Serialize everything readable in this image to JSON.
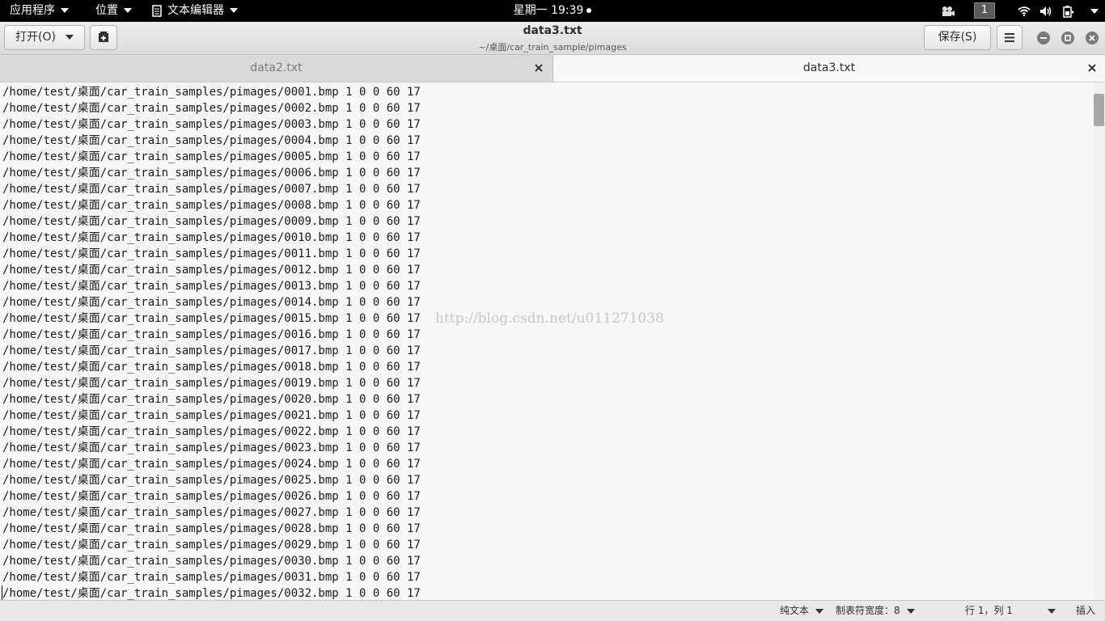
{
  "topbar": {
    "apps_menu": "应用程序",
    "places_menu": "位置",
    "app_menu": "文本编辑器",
    "clock": "星期一 19:39",
    "workspace": "1"
  },
  "header": {
    "open_button": "打开(O)",
    "title": "data3.txt",
    "subtitle": "~/桌面/car_train_sample/pimages",
    "save_button": "保存(S)"
  },
  "tabs": [
    {
      "label": "data2.txt",
      "active": false
    },
    {
      "label": "data3.txt",
      "active": true
    }
  ],
  "editor": {
    "lines": [
      "/home/test/桌面/car_train_samples/pimages/0001.bmp 1 0 0 60 17",
      "/home/test/桌面/car_train_samples/pimages/0002.bmp 1 0 0 60 17",
      "/home/test/桌面/car_train_samples/pimages/0003.bmp 1 0 0 60 17",
      "/home/test/桌面/car_train_samples/pimages/0004.bmp 1 0 0 60 17",
      "/home/test/桌面/car_train_samples/pimages/0005.bmp 1 0 0 60 17",
      "/home/test/桌面/car_train_samples/pimages/0006.bmp 1 0 0 60 17",
      "/home/test/桌面/car_train_samples/pimages/0007.bmp 1 0 0 60 17",
      "/home/test/桌面/car_train_samples/pimages/0008.bmp 1 0 0 60 17",
      "/home/test/桌面/car_train_samples/pimages/0009.bmp 1 0 0 60 17",
      "/home/test/桌面/car_train_samples/pimages/0010.bmp 1 0 0 60 17",
      "/home/test/桌面/car_train_samples/pimages/0011.bmp 1 0 0 60 17",
      "/home/test/桌面/car_train_samples/pimages/0012.bmp 1 0 0 60 17",
      "/home/test/桌面/car_train_samples/pimages/0013.bmp 1 0 0 60 17",
      "/home/test/桌面/car_train_samples/pimages/0014.bmp 1 0 0 60 17",
      "/home/test/桌面/car_train_samples/pimages/0015.bmp 1 0 0 60 17",
      "/home/test/桌面/car_train_samples/pimages/0016.bmp 1 0 0 60 17",
      "/home/test/桌面/car_train_samples/pimages/0017.bmp 1 0 0 60 17",
      "/home/test/桌面/car_train_samples/pimages/0018.bmp 1 0 0 60 17",
      "/home/test/桌面/car_train_samples/pimages/0019.bmp 1 0 0 60 17",
      "/home/test/桌面/car_train_samples/pimages/0020.bmp 1 0 0 60 17",
      "/home/test/桌面/car_train_samples/pimages/0021.bmp 1 0 0 60 17",
      "/home/test/桌面/car_train_samples/pimages/0022.bmp 1 0 0 60 17",
      "/home/test/桌面/car_train_samples/pimages/0023.bmp 1 0 0 60 17",
      "/home/test/桌面/car_train_samples/pimages/0024.bmp 1 0 0 60 17",
      "/home/test/桌面/car_train_samples/pimages/0025.bmp 1 0 0 60 17",
      "/home/test/桌面/car_train_samples/pimages/0026.bmp 1 0 0 60 17",
      "/home/test/桌面/car_train_samples/pimages/0027.bmp 1 0 0 60 17",
      "/home/test/桌面/car_train_samples/pimages/0028.bmp 1 0 0 60 17",
      "/home/test/桌面/car_train_samples/pimages/0029.bmp 1 0 0 60 17",
      "/home/test/桌面/car_train_samples/pimages/0030.bmp 1 0 0 60 17",
      "/home/test/桌面/car_train_samples/pimages/0031.bmp 1 0 0 60 17",
      "/home/test/桌面/car_train_samples/pimages/0032.bmp 1 0 0 60 17"
    ],
    "watermark": "http://blog.csdn.net/u011271038"
  },
  "statusbar": {
    "language": "纯文本",
    "tab_width": "制表符宽度：8",
    "position": "行 1，列 1",
    "mode": "插入"
  },
  "colors": {
    "topbar_bg": "#000000",
    "headerbar_bg": "#e3e3e3",
    "editor_bg": "#f7f7f7",
    "inactive_tab_bg": "#dadada"
  }
}
